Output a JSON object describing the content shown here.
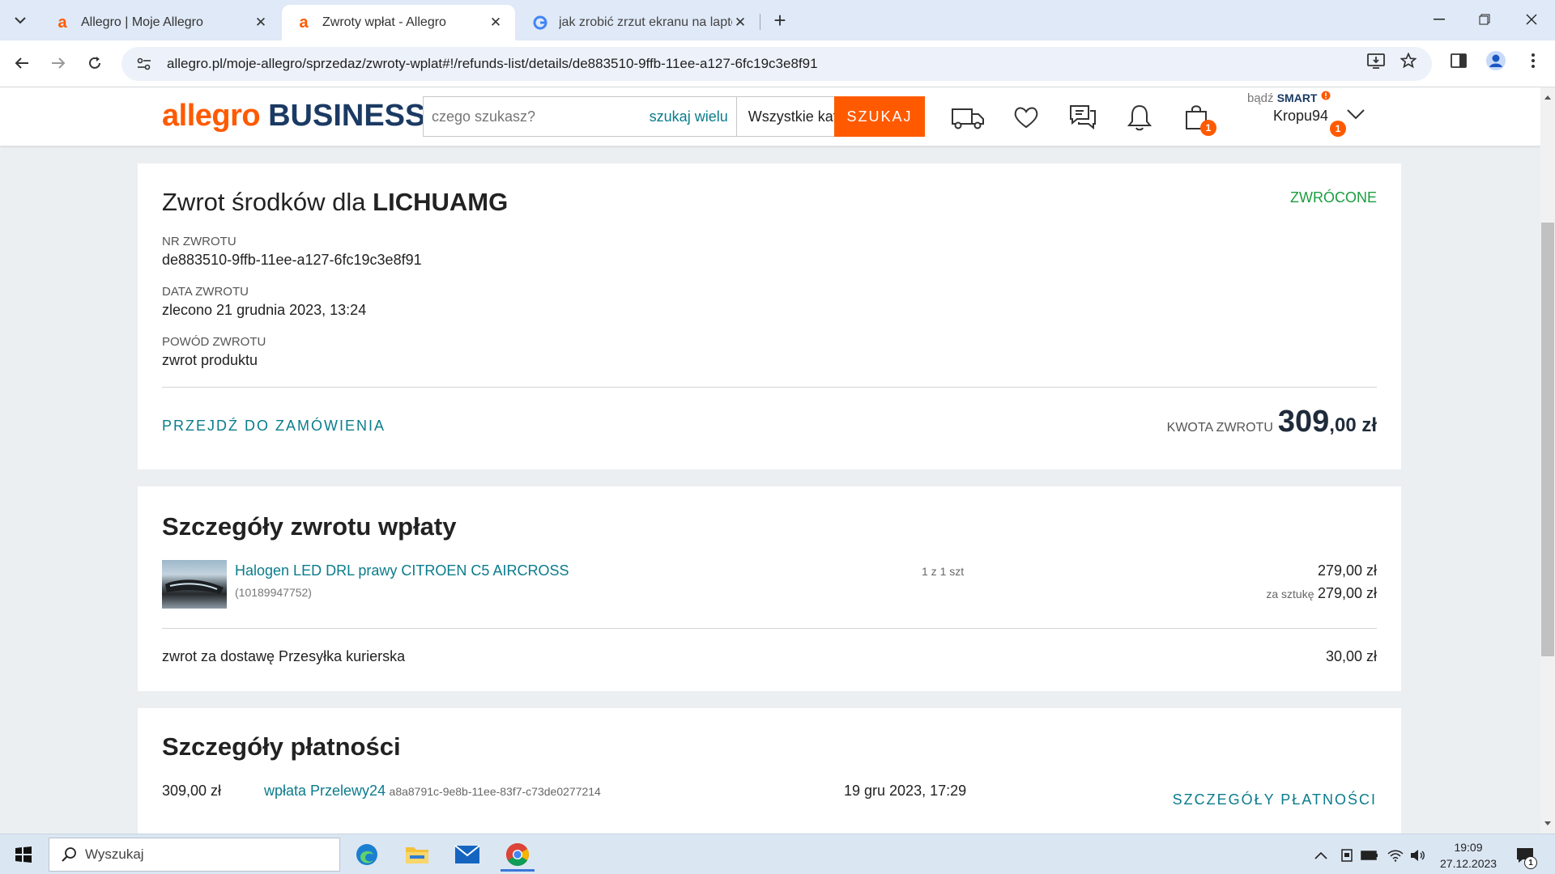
{
  "browser": {
    "tabs": [
      {
        "title": "Allegro | Moje Allegro",
        "favicon": "allegro-icon",
        "active": false
      },
      {
        "title": "Zwroty wpłat - Allegro",
        "favicon": "allegro-icon",
        "active": true
      },
      {
        "title": "jak zrobić zrzut ekranu na lapto",
        "favicon": "google-icon",
        "active": false
      }
    ],
    "url": "allegro.pl/moje-allegro/sprzedaz/zwroty-wplat#!/refunds-list/details/de883510-9ffb-11ee-a127-6fc19c3e8f91"
  },
  "header": {
    "logo_main": "allegro",
    "logo_sub": "BUSINESS",
    "search_placeholder": "czego szukasz?",
    "search_multi": "szukaj wielu",
    "category": "Wszystkie kategorie",
    "search_button": "SZUKAJ",
    "cart_badge": "1",
    "smart_prefix": "bądź",
    "smart_label": "SMART",
    "username": "Kropu94",
    "user_badge": "1"
  },
  "refund": {
    "title_prefix": "Zwrot środków dla",
    "seller": "LICHUAMG",
    "status": "ZWRÓCONE",
    "number_label": "NR ZWROTU",
    "number": "de883510-9ffb-11ee-a127-6fc19c3e8f91",
    "date_label": "DATA ZWROTU",
    "date": "zlecono 21 grudnia 2023, 13:24",
    "reason_label": "POWÓD ZWROTU",
    "reason": "zwrot produktu",
    "order_link": "PRZEJDŹ DO ZAMÓWIENIA",
    "amount_label": "KWOTA ZWROTU",
    "amount_int": "309",
    "amount_dec": ",00 zł"
  },
  "details": {
    "title": "Szczegóły zwrotu wpłaty",
    "item_name": "Halogen LED DRL prawy CITROEN C5 AIRCROSS",
    "item_id": "(10189947752)",
    "item_qty": "1 z 1 szt",
    "item_total": "279,00 zł",
    "per_item_label": "za sztukę",
    "per_item_price": "279,00 zł",
    "delivery_label": "zwrot za dostawę Przesyłka kurierska",
    "delivery_amount": "30,00 zł"
  },
  "payment": {
    "title": "Szczegóły płatności",
    "amount": "309,00 zł",
    "method": "wpłata Przelewy24",
    "transaction_id": "a8a8791c-9e8b-11ee-83f7-c73de0277214",
    "date": "19 gru 2023, 17:29",
    "details_link": "SZCZEGÓŁY PŁATNOŚCI"
  },
  "taskbar": {
    "search_text": "Wyszukaj",
    "time": "19:09",
    "date": "27.12.2023",
    "notification_count": "1"
  }
}
